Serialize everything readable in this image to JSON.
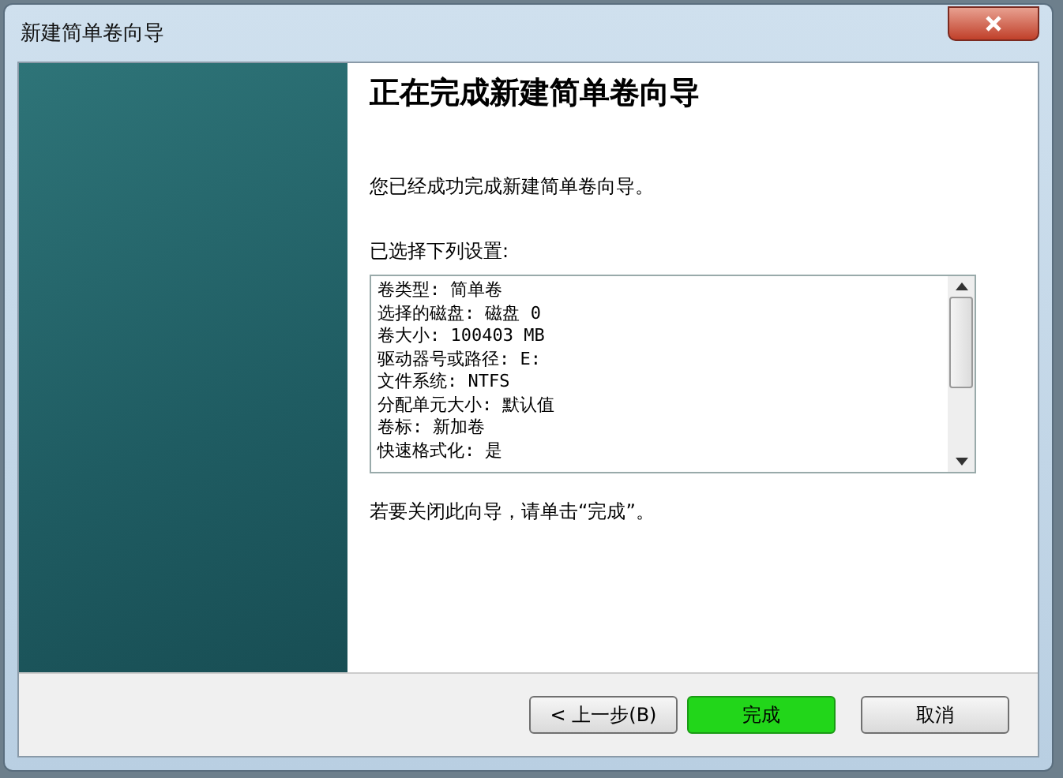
{
  "window": {
    "title": "新建简单卷向导"
  },
  "heading": "正在完成新建简单卷向导",
  "intro": "您已经成功完成新建简单卷向导。",
  "settings_label": "已选择下列设置:",
  "settings": [
    "卷类型: 简单卷",
    "选择的磁盘: 磁盘 0",
    "卷大小: 100403 MB",
    "驱动器号或路径: E:",
    "文件系统: NTFS",
    "分配单元大小: 默认值",
    "卷标: 新加卷",
    "快速格式化: 是"
  ],
  "closing_hint": "若要关闭此向导，请单击“完成”。",
  "buttons": [
    {
      "label": "< 上一步(B)",
      "highlighted": false
    },
    {
      "label": "完成",
      "highlighted": true
    },
    {
      "label": "取消",
      "highlighted": false
    }
  ]
}
